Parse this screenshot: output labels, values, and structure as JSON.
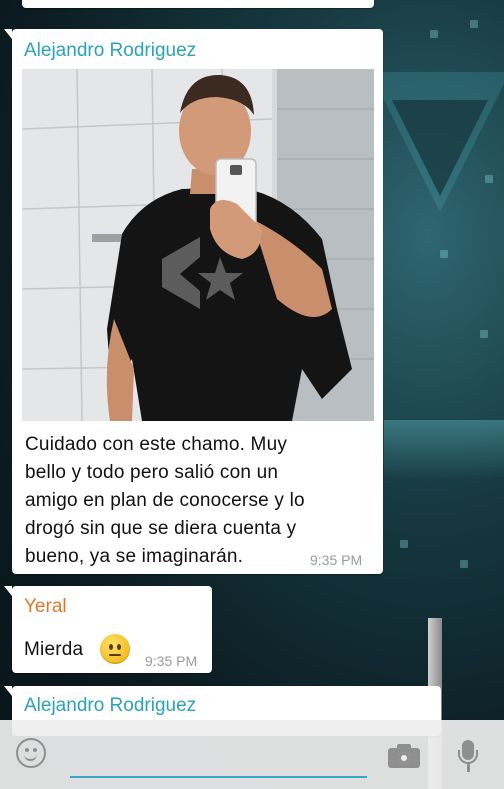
{
  "messages": [
    {
      "sender": "Alejandro Rodriguez",
      "text_lines": [
        "Cuidado con este chamo. Muy",
        "bello y todo pero salió con un",
        "amigo en plan de conocerse y lo",
        "drogó sin que se diera cuenta y",
        "bueno, ya se imaginarán."
      ],
      "time": "9:35 PM",
      "has_photo": true,
      "sender_color": "#2aa3b5"
    },
    {
      "sender": "Yeral",
      "text": "Mierda",
      "emoji": "neutral-face",
      "time": "9:35 PM",
      "sender_color": "#e0782a"
    },
    {
      "sender": "Alejandro Rodriguez",
      "sender_color": "#2aa3b5"
    }
  ],
  "input_bar": {
    "placeholder": "",
    "accent_color": "#3aa6c7",
    "icons": [
      "emoji-icon",
      "camera-icon",
      "mic-icon"
    ]
  }
}
